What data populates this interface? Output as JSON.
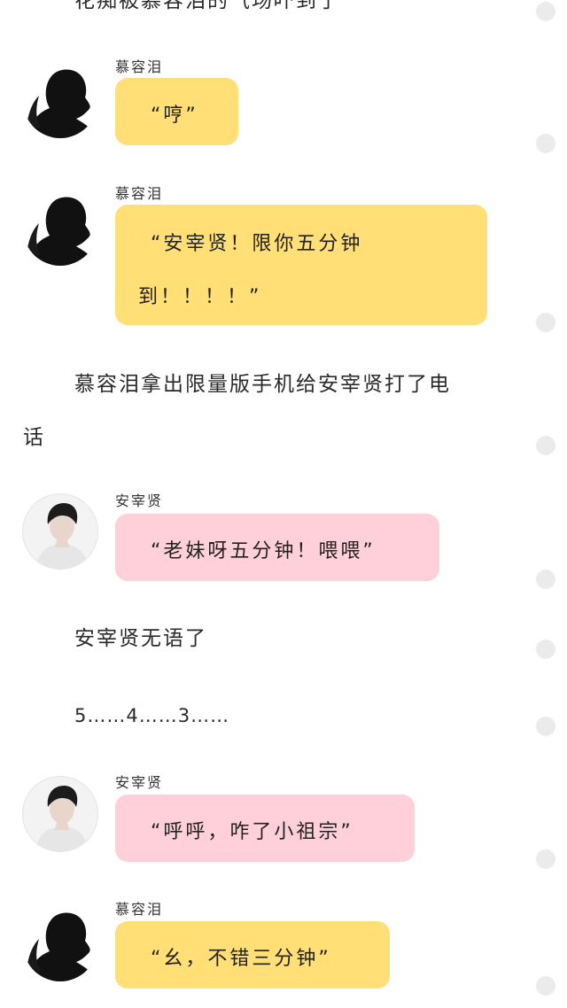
{
  "narration": {
    "top_partial": "花痴被慕容泪的气场吓到了",
    "call_line1": "慕容泪拿出限量版手机给安宰贤打了电",
    "call_line2": "话",
    "speechless": "安宰贤无语了",
    "countdown": "5……4……3……"
  },
  "messages": [
    {
      "sender": "慕容泪",
      "lines": [
        "“哼”"
      ],
      "bubble_color": "#ffdf76"
    },
    {
      "sender": "慕容泪",
      "lines": [
        "“安宰贤！限你五分钟",
        "到！！！！”"
      ],
      "bubble_color": "#ffdf76"
    },
    {
      "sender": "安宰贤",
      "lines": [
        "“老妹呀五分钟！喂喂”"
      ],
      "bubble_color": "#ffd0d9"
    },
    {
      "sender": "安宰贤",
      "lines": [
        "“呼呼，咋了小祖宗”"
      ],
      "bubble_color": "#ffd0d9"
    },
    {
      "sender": "慕容泪",
      "lines": [
        "“幺，不错三分钟”"
      ],
      "bubble_color": "#ffdf76"
    }
  ],
  "avatars": {
    "female": "female-silhouette-avatar",
    "male": "male-portrait-avatar"
  }
}
